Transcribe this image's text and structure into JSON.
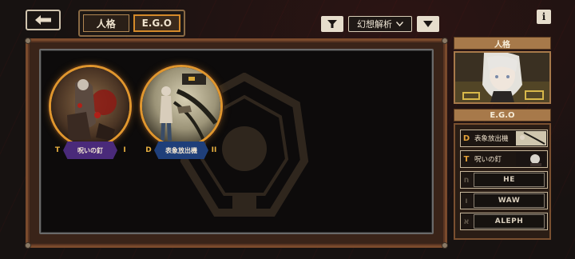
{
  "top_bar": {
    "back_icon": "back-arrow-icon",
    "tabs": [
      {
        "label": "人格",
        "active": false
      },
      {
        "label": "E.G.O",
        "active": true
      }
    ],
    "filter_icon": "filter-icon",
    "sort_label": "幻想解析",
    "sort_icon": "chevron-down-icon",
    "order_icon": "sort-order-icon",
    "info_label": "i"
  },
  "ego_grid": [
    {
      "name": "呪いの釘",
      "grade_left": "T",
      "grade_right": "I",
      "label_color": "#4a2a7a"
    },
    {
      "name": "表象放出機",
      "grade_left": "D",
      "grade_right": "II",
      "label_color": "#1f3f7a"
    }
  ],
  "side_panel": {
    "identity_header": "人格",
    "ego_header": "E.G.O",
    "slots": [
      {
        "grade": "D",
        "name": "表象放出機",
        "filled": true
      },
      {
        "grade": "T",
        "name": "呪いの釘",
        "filled": true
      },
      {
        "grade": "ח",
        "name": "HE",
        "filled": false
      },
      {
        "grade": "ו",
        "name": "WAW",
        "filled": false
      },
      {
        "grade": "א",
        "name": "ALEPH",
        "filled": false
      }
    ]
  },
  "colors": {
    "accent_orange": "#e0962e",
    "panel_brown": "#7a4a2c",
    "header_tan": "#a7794a"
  }
}
